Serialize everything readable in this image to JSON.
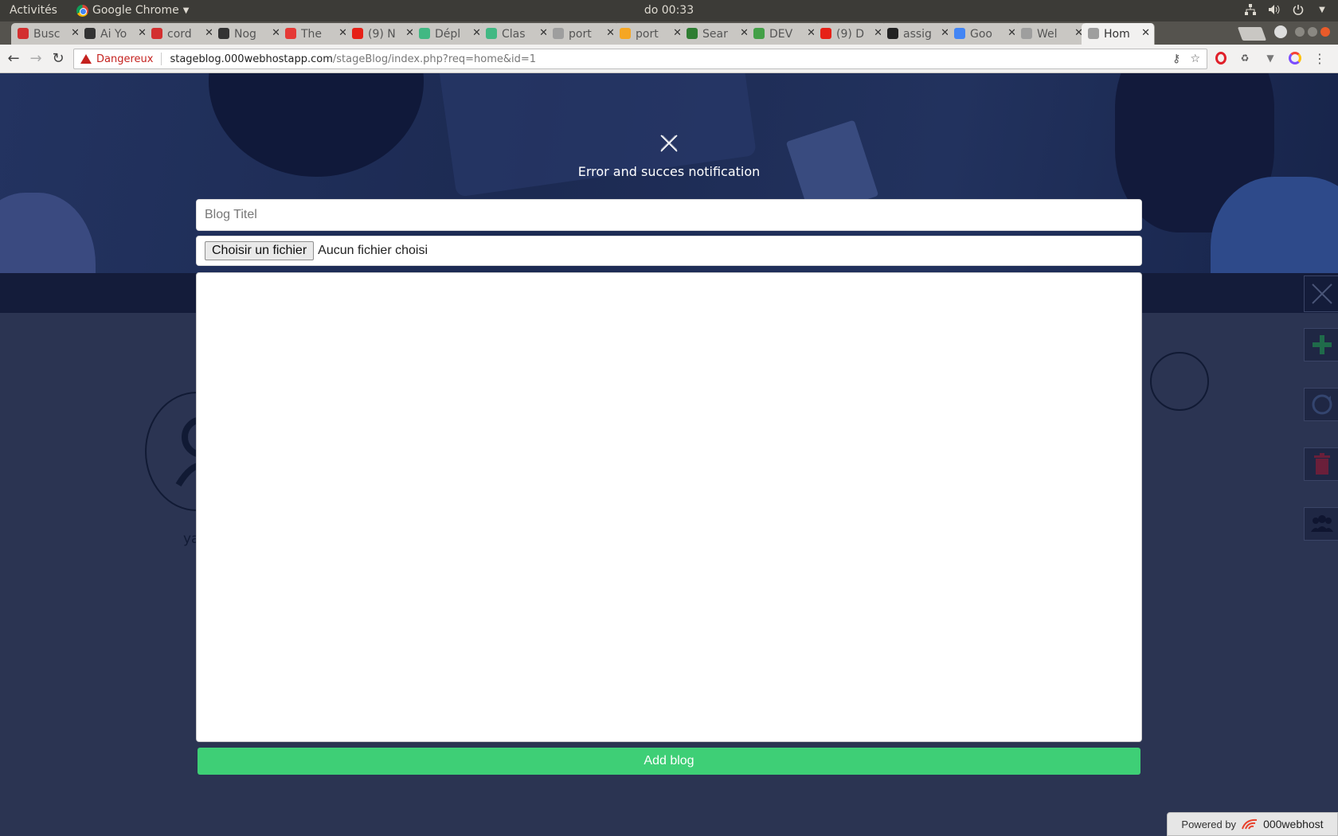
{
  "system_bar": {
    "activities": "Activités",
    "app_name": "Google Chrome",
    "clock": "do 00:33"
  },
  "tabs": [
    {
      "label": "Busc",
      "favicon_color": "#d32f2f"
    },
    {
      "label": "Ai Yo",
      "favicon_color": "#333333"
    },
    {
      "label": "cord",
      "favicon_color": "#d32f2f"
    },
    {
      "label": "Nog",
      "favicon_color": "#333333"
    },
    {
      "label": "The",
      "favicon_color": "#e53935"
    },
    {
      "label": "(9) N",
      "favicon_color": "#e62117"
    },
    {
      "label": "Dépl",
      "favicon_color": "#41b883"
    },
    {
      "label": "Clas",
      "favicon_color": "#41b883"
    },
    {
      "label": "port",
      "favicon_color": "#9e9e9e"
    },
    {
      "label": "port",
      "favicon_color": "#f5a623"
    },
    {
      "label": "Sear",
      "favicon_color": "#2e7d32"
    },
    {
      "label": "DEV",
      "favicon_color": "#43a047"
    },
    {
      "label": "(9) D",
      "favicon_color": "#e62117"
    },
    {
      "label": "assig",
      "favicon_color": "#222222"
    },
    {
      "label": "Goo",
      "favicon_color": "#4285f4"
    },
    {
      "label": "Wel",
      "favicon_color": "#9e9e9e"
    },
    {
      "label": "Hom",
      "favicon_color": "#9e9e9e",
      "active": true
    }
  ],
  "address_bar": {
    "security_label": "Dangereux",
    "url_host": "stageblog.000webhostapp.com",
    "url_path": "/stageBlog/index.php?req=home&id=1"
  },
  "notification": {
    "text": "Error and succes notification"
  },
  "form": {
    "title_placeholder": "Blog Titel",
    "file_button_label": "Choisir un fichier",
    "file_status": "Aucun fichier choisi",
    "content_value": "",
    "submit_label": "Add blog"
  },
  "background": {
    "avatar_label": "ya"
  },
  "footer": {
    "powered_label": "Powered by",
    "brand": "000webhost"
  },
  "colors": {
    "accent_green": "#3ecf76",
    "page_bg": "#2b3452",
    "danger_red": "#c5221f"
  }
}
